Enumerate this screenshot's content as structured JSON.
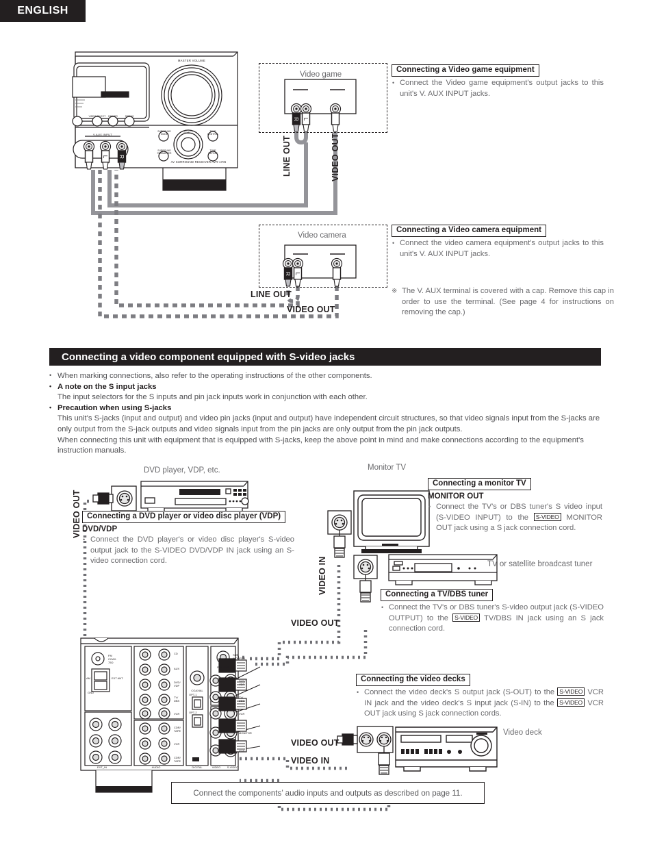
{
  "page": {
    "language_tab": "ENGLISH"
  },
  "section": {
    "title": "Connecting a video component equipped with S-video jacks",
    "paragraphs": [
      "When marking connections, also refer to the operating instructions of the other components.",
      "A note on the S input jacks",
      "The input selectors for the S inputs and pin jack inputs work in conjunction with each other.",
      "Precaution when using S-jacks",
      "This unit's S-jacks (input and output) and video pin jacks (input and output) have independent circuit structures, so that video signals input from the S-jacks are only output from the S-jack outputs and video signals input from the pin jacks are only output from the pin jack outputs.",
      "When connecting this unit with equipment that is equipped with S-jacks, keep the above point in mind and make connections according to the equipment's instruction manuals."
    ]
  },
  "top_diagram": {
    "receiver_label": "AV SURROUND RECEIVER AVR-1706",
    "receiver_master_volume": "MASTER VOLUME",
    "receiver_vaux_input": "V.AUX INPUT",
    "video_game": {
      "device_label": "Video game",
      "jack_r": "R",
      "jack_l": "L",
      "line_out": "LINE OUT",
      "video_out": "VIDEO OUT"
    },
    "video_camera": {
      "device_label": "Video camera",
      "jack_r": "R",
      "jack_l": "L",
      "line_out": "LINE OUT",
      "video_out": "VIDEO OUT"
    },
    "callouts": [
      {
        "title": "Connecting a Video game equipment",
        "body": "Connect the Video game equipment's output jacks to this unit's V. AUX INPUT jacks."
      },
      {
        "title": "Connecting a Video camera equipment",
        "body": "Connect the video camera equipment's output jacks to this unit's V. AUX INPUT jacks."
      }
    ],
    "note": {
      "mark": "※",
      "text": "The V. AUX terminal is covered with a cap.  Remove this cap in order to use the terminal. (See page 4 for instructions on removing the cap.)"
    }
  },
  "bottom_diagram": {
    "dvd": {
      "device_label": "DVD player, VDP, etc.",
      "video_out": "VIDEO OUT",
      "callout_title": "Connecting a DVD player or video disc player (VDP)",
      "callout_sub": "DVD/VDP",
      "callout_body": "Connect the DVD player's or video disc player's S-video output jack to the S-VIDEO DVD/VDP IN jack using an S-video connection cord."
    },
    "monitor_tv": {
      "device_label": "Monitor TV",
      "video_in": "VIDEO IN",
      "callout_title": "Connecting a monitor TV",
      "callout_sub": "MONITOR OUT",
      "callout_body_1": "Connect the TV's or DBS tuner's S video input (S-VIDEO INPUT) to the",
      "badge": "S-VIDEO",
      "callout_body_2": "MONITOR OUT jack using a S jack connection cord."
    },
    "tv_dbs": {
      "device_label": "TV or satellite broadcast tuner",
      "video_out": "VIDEO OUT",
      "callout_title": "Connecting a TV/DBS tuner",
      "callout_body_1": "Connect the TV's or DBS tuner's S-video output jack (S-VIDEO OUTPUT) to the",
      "badge": "S-VIDEO",
      "callout_body_2": "TV/DBS IN jack using an S jack connection cord."
    },
    "video_deck": {
      "device_label": "Video deck",
      "video_out": "VIDEO OUT",
      "video_in": "VIDEO IN",
      "callout_title": "Connecting the video decks",
      "callout_body_1": "Connect the video deck's S output jack (S-OUT) to the",
      "badge_1": "S-VIDEO",
      "callout_body_2": "VCR IN jack and the video deck's S input jack (S-IN) to the",
      "badge_2": "S-VIDEO",
      "callout_body_3": "VCR OUT jack using S jack connection cords."
    },
    "rear_panel": {
      "labels": [
        "FM COAX 75Ω",
        "AM",
        "EXT ANT.",
        "EXT IN",
        "AUDIO",
        "DIGITAL",
        "VIDEO",
        "S-VIDEO",
        "PRE OUT",
        "SUB WOOFER",
        "CD",
        "AUX",
        "DVD/VDP",
        "TV/DBS",
        "VCR",
        "CDR/TAPE",
        "OPT-1",
        "OPT-2",
        "COAXIAL",
        "MONITOR"
      ]
    }
  },
  "footer": {
    "note": "Connect the components’ audio inputs and outputs as described on page 11."
  },
  "colors": {
    "ink": "#231f20",
    "body_text": "#6a6a6d",
    "cable_gray": "#949499"
  }
}
